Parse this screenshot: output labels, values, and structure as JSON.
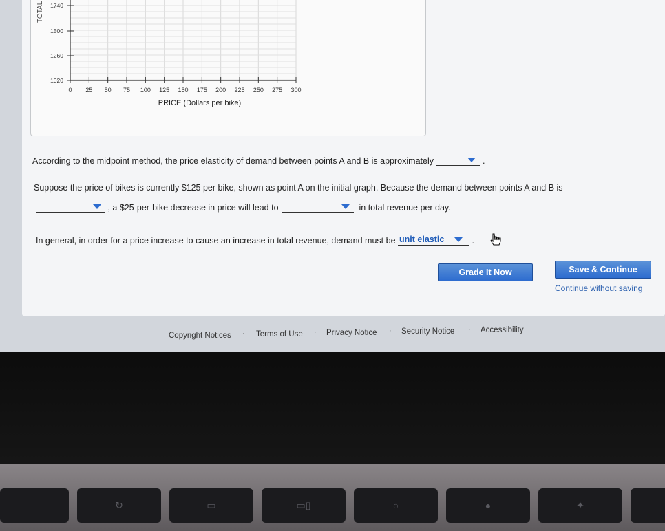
{
  "graph": {
    "y_axis_label": "TOTAL",
    "y_ticks": [
      "1740",
      "1500",
      "1260",
      "1020"
    ],
    "x_ticks": [
      "0",
      "25",
      "50",
      "75",
      "100",
      "125",
      "150",
      "175",
      "200",
      "225",
      "250",
      "275",
      "300"
    ],
    "x_axis_label": "PRICE (Dollars per bike)"
  },
  "questions": {
    "q1": {
      "text": "According to the midpoint method, the price elasticity of demand between points A and B is approximately",
      "selected": "",
      "end": "."
    },
    "q2": {
      "line1": "Suppose the price of bikes is currently $125 per bike, shown as point A on the initial graph. Because the demand between points A and B is",
      "mid": ", a $25-per-bike decrease in price will lead to",
      "end": "in total revenue per day.",
      "selected_1": "",
      "selected_2": ""
    },
    "q3": {
      "text": "In general, in order for a price increase to cause an increase in total revenue, demand must be",
      "selected": "unit elastic",
      "end": "."
    }
  },
  "actions": {
    "grade": "Grade It Now",
    "save": "Save & Continue",
    "continue_link": "Continue without saving"
  },
  "footer": {
    "links": [
      "Copyright Notices",
      "Terms of Use",
      "Privacy Notice",
      "Security Notice",
      "Accessibility"
    ]
  }
}
